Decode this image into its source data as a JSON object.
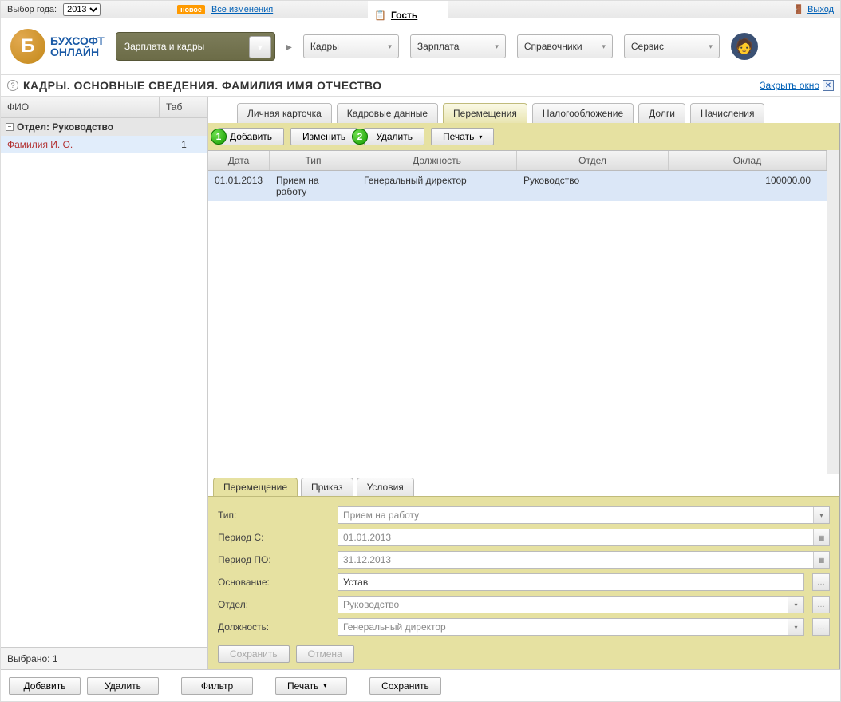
{
  "topbar": {
    "year_label": "Выбор года:",
    "year_value": "2013",
    "badge_new": "новое",
    "changes_link": "Все изменения",
    "guest": "Гость",
    "logout": "Выход"
  },
  "logo": {
    "line1": "БУХСОФТ",
    "line2": "ОНЛАЙН"
  },
  "module_name": "Зарплата и кадры",
  "nav": [
    "Кадры",
    "Зарплата",
    "Справочники",
    "Сервис"
  ],
  "page_title": "КАДРЫ. ОСНОВНЫЕ СВЕДЕНИЯ. ФАМИЛИЯ ИМЯ ОТЧЕСТВО",
  "close_window": "Закрыть окно",
  "left": {
    "cols": [
      "ФИО",
      "Таб"
    ],
    "dept": "Отдел: Руководство",
    "employee": {
      "name": "Фамилия И. О.",
      "tab": "1"
    },
    "selected_text": "Выбрано: 1"
  },
  "tabs": [
    "Личная карточка",
    "Кадровые данные",
    "Перемещения",
    "Налогообложение",
    "Долги",
    "Начисления"
  ],
  "active_tab_index": 2,
  "toolbar": {
    "add": "Добавить",
    "edit": "Изменить",
    "delete": "Удалить",
    "print": "Печать"
  },
  "grid": {
    "headers": [
      "Дата",
      "Тип",
      "Должность",
      "Отдел",
      "Оклад"
    ],
    "row": {
      "date": "01.01.2013",
      "type": "Прием на работу",
      "position": "Генеральный директор",
      "dept": "Руководство",
      "salary": "100000.00"
    }
  },
  "sub_tabs": [
    "Перемещение",
    "Приказ",
    "Условия"
  ],
  "form": {
    "type_label": "Тип:",
    "type_value": "Прием на работу",
    "from_label": "Период С:",
    "from_value": "01.01.2013",
    "to_label": "Период ПО:",
    "to_value": "31.12.2013",
    "reason_label": "Основание:",
    "reason_value": "Устав",
    "dept_label": "Отдел:",
    "dept_value": "Руководство",
    "pos_label": "Должность:",
    "pos_value": "Генеральный директор"
  },
  "form_buttons": {
    "save": "Сохранить",
    "cancel": "Отмена"
  },
  "footer": {
    "add": "Добавить",
    "delete": "Удалить",
    "filter": "Фильтр",
    "print": "Печать",
    "save": "Сохранить"
  }
}
